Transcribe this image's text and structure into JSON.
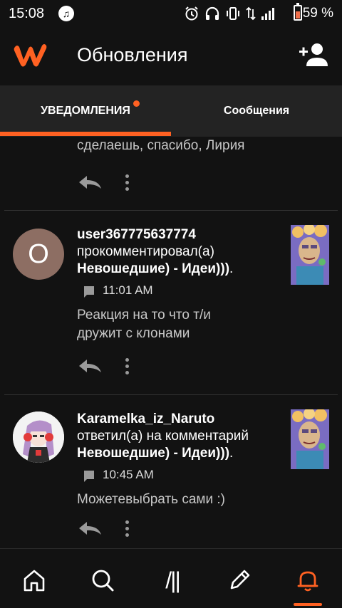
{
  "status": {
    "time": "15:08",
    "battery_pct": "59 %"
  },
  "header": {
    "title": "Обновления",
    "logo_icon": "wattpad-w-icon",
    "action_icon": "add-user-icon"
  },
  "tabs": {
    "notifications": "УВЕДОМЛЕНИЯ",
    "messages": "Сообщения",
    "notifications_badge_color": "#ff6122"
  },
  "feed": {
    "partial": {
      "comment": "сделаешь, спасибо, Лирия"
    },
    "items": [
      {
        "avatar_letter": "О",
        "username": "user367775637774",
        "action": "прокомментировал(а)",
        "story": "Невошедшие) - Идеи)))",
        "story_suffix": ".",
        "time": "11:01 AM",
        "comment_line1": "Реакция на то что т/и",
        "comment_line2": "дружит с клонами"
      },
      {
        "avatar_letter": "",
        "username": "Karamelka_iz_Naruto",
        "action": "ответил(а) на комментарий",
        "story": "Невошедшие) - Идеи)))",
        "story_suffix": ".",
        "time": "10:45 AM",
        "comment_line1": "Можетевыбрать сами :)",
        "comment_line2": ""
      }
    ]
  },
  "nav": {
    "library_label": "/||",
    "active": "notifications",
    "accent_color": "#ff6122"
  }
}
